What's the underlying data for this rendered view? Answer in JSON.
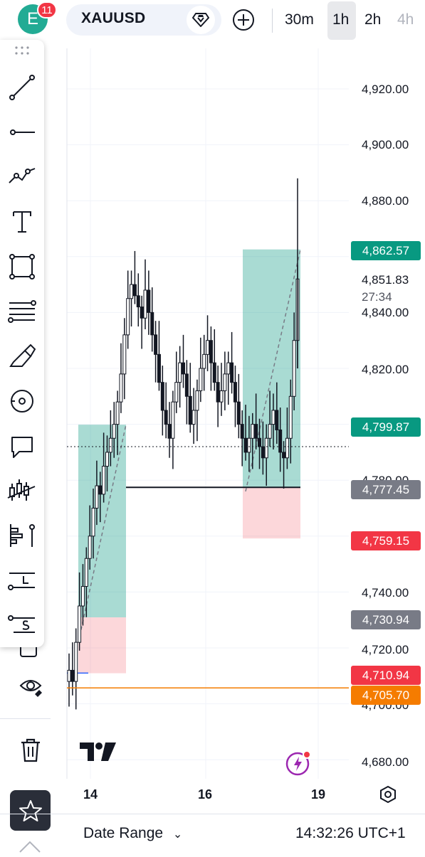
{
  "header": {
    "avatar_letter": "E",
    "notification_count": "11",
    "symbol": "XAUUSD",
    "timeframes": [
      {
        "label": "30m",
        "active": false
      },
      {
        "label": "1h",
        "active": true
      },
      {
        "label": "2h",
        "active": false
      },
      {
        "label": "4h",
        "active": false
      }
    ]
  },
  "toolbar": {
    "tools": [
      {
        "name": "trend-line-tool-icon"
      },
      {
        "name": "horizontal-ray-tool-icon"
      },
      {
        "name": "path-tool-icon"
      },
      {
        "name": "text-tool-icon"
      },
      {
        "name": "rectangle-tool-icon"
      },
      {
        "name": "fib-retracement-tool-icon"
      },
      {
        "name": "brush-tool-icon"
      },
      {
        "name": "magnet-tool-icon"
      },
      {
        "name": "comment-tool-icon"
      },
      {
        "name": "patterns-tool-icon"
      },
      {
        "name": "prediction-tool-icon"
      },
      {
        "name": "long-position-tool-icon",
        "letter": "L"
      },
      {
        "name": "short-position-tool-icon",
        "letter": "S"
      }
    ]
  },
  "left_controls": {
    "visibility_icon": "eye-icon",
    "delete_icon": "trash-icon",
    "favorites_icon": "star-icon"
  },
  "price_axis": {
    "labels": [
      "4,920.00",
      "4,900.00",
      "4,880.00",
      "4,840.00",
      "4,820.00",
      "4,740.00",
      "4,720.00",
      "4,680.00"
    ],
    "partial_labels": [
      "4,780.00",
      "4,700.00"
    ],
    "current_price": "4,851.83",
    "countdown": "27:34",
    "tags": [
      {
        "value": "4,862.57",
        "color": "#089981"
      },
      {
        "value": "4,799.87",
        "color": "#089981"
      },
      {
        "value": "4,777.45",
        "color": "#787b86"
      },
      {
        "value": "4,759.15",
        "color": "#f23645"
      },
      {
        "value": "4,730.94",
        "color": "#787b86"
      },
      {
        "value": "4,710.94",
        "color": "#f23645"
      },
      {
        "value": "4,705.70",
        "color": "#f57c00"
      }
    ]
  },
  "time_axis": {
    "labels": [
      "14",
      "16",
      "19"
    ]
  },
  "bottom_bar": {
    "date_range_label": "Date Range",
    "clock": "14:32:26 UTC+1"
  },
  "chart_data": {
    "type": "candlestick",
    "symbol": "XAUUSD",
    "timeframe": "1h",
    "ylim": [
      4670,
      4935
    ],
    "x_ticks": [
      "14",
      "16",
      "19"
    ],
    "last_price": 4851.83,
    "close_series": [
      4712,
      4708,
      4722,
      4735,
      4742,
      4752,
      4760,
      4770,
      4778,
      4775,
      4785,
      4790,
      4795,
      4800,
      4808,
      4818,
      4832,
      4845,
      4850,
      4846,
      4842,
      4838,
      4848,
      4840,
      4832,
      4825,
      4815,
      4805,
      4800,
      4795,
      4808,
      4815,
      4822,
      4818,
      4810,
      4800,
      4805,
      4812,
      4820,
      4825,
      4830,
      4822,
      4815,
      4808,
      4812,
      4818,
      4822,
      4815,
      4808,
      4800,
      4795,
      4790,
      4795,
      4800,
      4795,
      4792,
      4788,
      4795,
      4800,
      4805,
      4798,
      4790,
      4788,
      4795,
      4810,
      4830,
      4852
    ],
    "positions": [
      {
        "type": "long",
        "entry": 4730.94,
        "target": 4799.87,
        "stop": 4710.94
      },
      {
        "type": "long",
        "entry": 4777.45,
        "target": 4862.57,
        "stop": 4759.15
      }
    ],
    "horizontal_lines": [
      {
        "value": 4705.7,
        "color": "#f57c00"
      },
      {
        "value": 4792,
        "style": "dotted"
      }
    ]
  }
}
